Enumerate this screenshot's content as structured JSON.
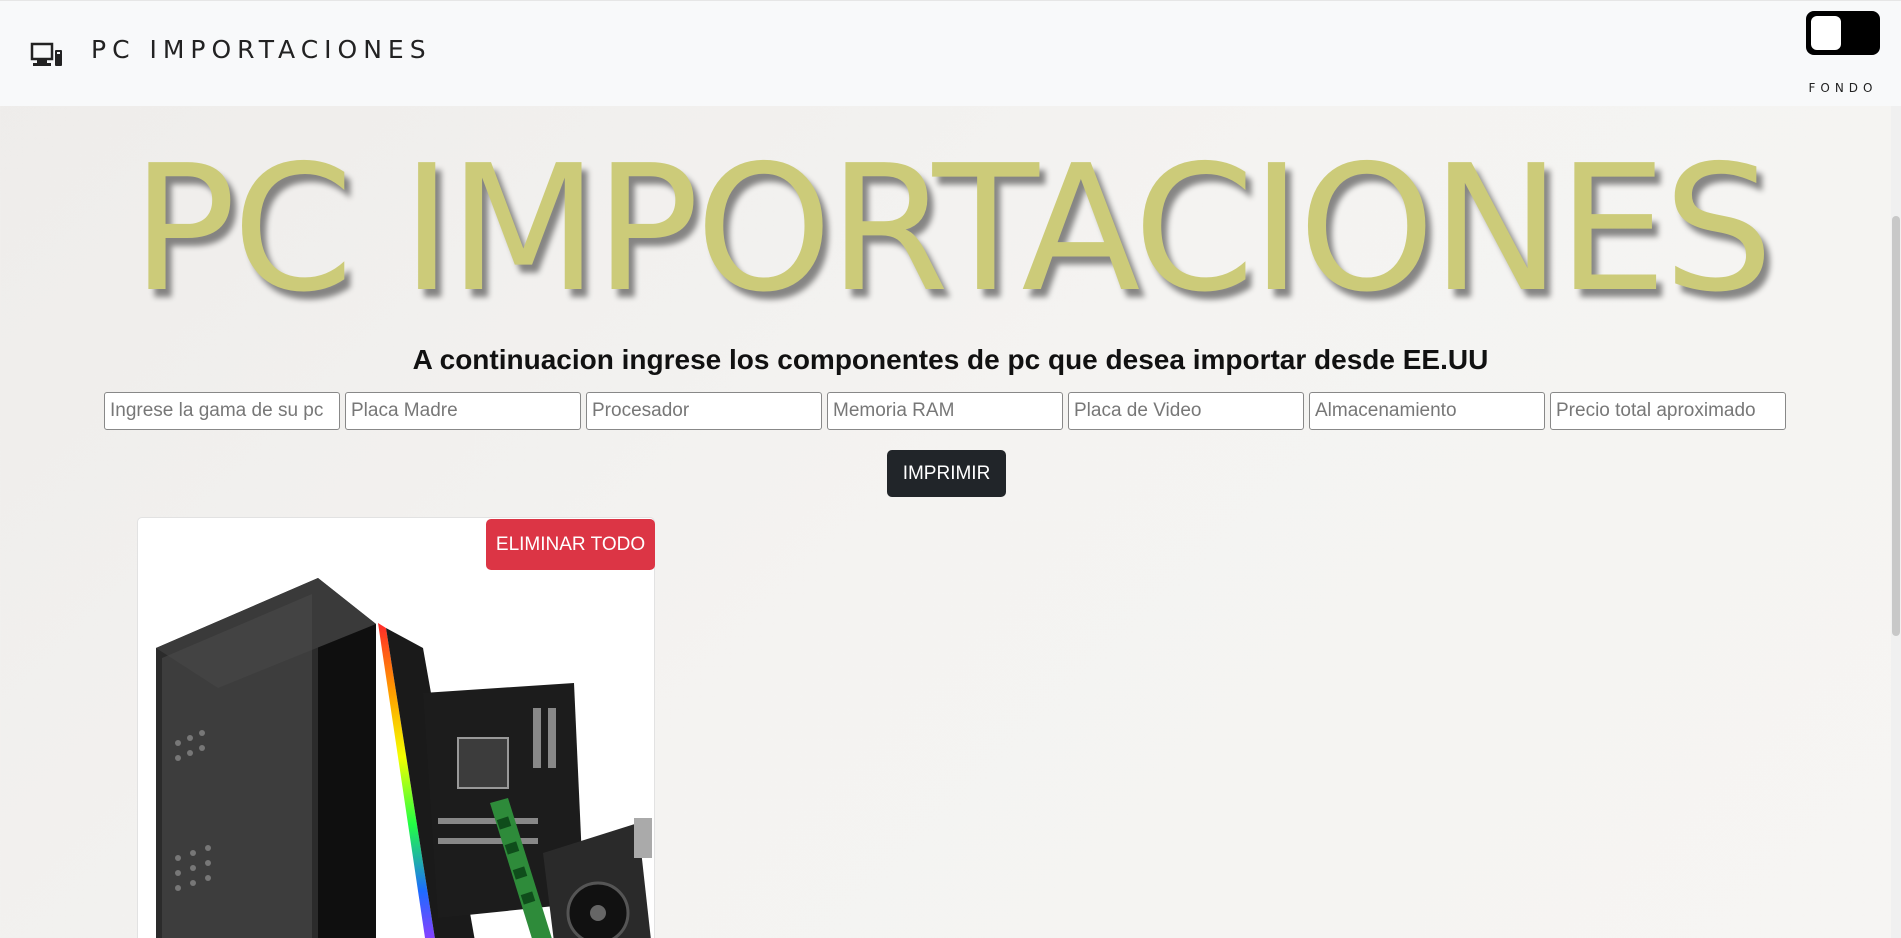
{
  "navbar": {
    "brand": "PC IMPORTACIONES",
    "brand_icon": "devices-icon",
    "toggle_label": "FONDO"
  },
  "hero": {
    "title": "PC IMPORTACIONES",
    "color": "#cccb79"
  },
  "form": {
    "instructions": "A continuacion ingrese los componentes de pc que desea importar desde EE.UU",
    "fields": [
      {
        "placeholder": "Ingrese la gama de su pc",
        "value": ""
      },
      {
        "placeholder": "Placa Madre",
        "value": ""
      },
      {
        "placeholder": "Procesador",
        "value": ""
      },
      {
        "placeholder": "Memoria RAM",
        "value": ""
      },
      {
        "placeholder": "Placa de Video",
        "value": ""
      },
      {
        "placeholder": "Almacenamiento",
        "value": ""
      },
      {
        "placeholder": "Precio total aproximado",
        "value": ""
      }
    ],
    "print_label": "IMPRIMIR"
  },
  "card": {
    "delete_label": "ELIMINAR TODO",
    "image": "pc-components-image"
  },
  "colors": {
    "navbar_bg": "#f8f9fa",
    "print_button": "#212529",
    "delete_button": "#dc3545"
  }
}
